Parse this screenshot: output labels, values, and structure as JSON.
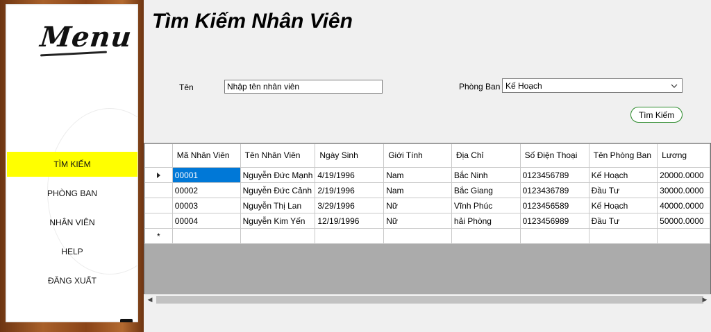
{
  "sidebar": {
    "title": "Menu",
    "items": [
      {
        "label": "TÌM KIẾM",
        "active": true
      },
      {
        "label": "PHÒNG BAN",
        "active": false
      },
      {
        "label": "NHÂN VIÊN",
        "active": false
      },
      {
        "label": "HELP",
        "active": false
      },
      {
        "label": "ĐĂNG XUẤT",
        "active": false
      }
    ]
  },
  "page": {
    "title": "Tìm Kiếm Nhân Viên"
  },
  "form": {
    "name_label": "Tên",
    "name_value": "Nhập tên nhân viên",
    "dept_label": "Phòng Ban",
    "dept_value": "Kế Hoạch",
    "search_button": "Tìm Kiếm"
  },
  "grid": {
    "columns": [
      "Mã Nhân Viên",
      "Tên Nhân Viên",
      "Ngày Sinh",
      "Giới Tính",
      "Địa Chỉ",
      "Số Điện Thoại",
      "Tên Phòng Ban",
      "Lương"
    ],
    "rows": [
      [
        "00001",
        "Nguyễn Đức Mạnh",
        "4/19/1996",
        "Nam",
        "Bắc Ninh",
        "0123456789",
        "Kế Hoạch",
        "20000.0000"
      ],
      [
        "00002",
        "Nguyễn Đức Cảnh",
        "2/19/1996",
        "Nam",
        "Bắc Giang",
        "0123436789",
        "Đầu Tư",
        "30000.0000"
      ],
      [
        "00003",
        "Nguyễn Thị Lan",
        "3/29/1996",
        "Nữ",
        "Vĩnh Phúc",
        "0123456589",
        "Kế Hoạch",
        "40000.0000"
      ],
      [
        "00004",
        "Nguyễn Kim Yến",
        "12/19/1996",
        "Nữ",
        "hải Phòng",
        "0123456989",
        "Đầu Tư",
        "50000.0000"
      ]
    ],
    "new_row_marker": "*",
    "accent": "#0078d7"
  }
}
